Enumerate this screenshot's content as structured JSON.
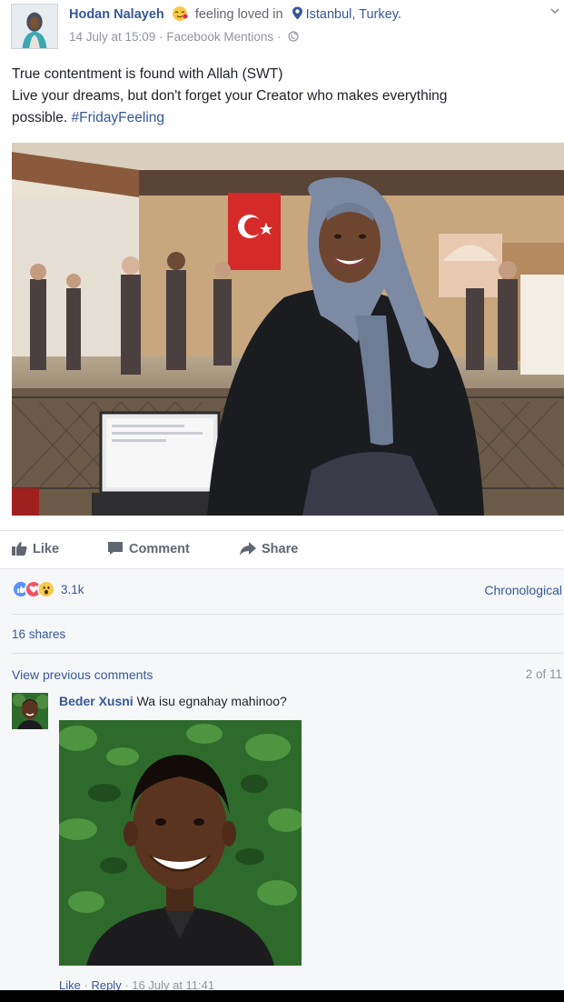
{
  "post": {
    "author": "Hodan Nalayeh",
    "feeling": "feeling loved in",
    "location": "Istanbul, Turkey.",
    "timestamp": "14 July at 15:09",
    "source": "Facebook Mentions",
    "separator": "·",
    "text_line1": "True contentment is found with Allah (SWT)",
    "text_line2": "Live your dreams, but don't forget your Creator who makes everything",
    "text_line3": "possible.",
    "hashtag": "#FridayFeeling",
    "icons": [
      "feeling-loved-emoji",
      "location-pin-icon",
      "globe-icon",
      "chevron-down-icon"
    ]
  },
  "actions": {
    "like": "Like",
    "comment": "Comment",
    "share": "Share"
  },
  "stats": {
    "reaction_count": "3.1k",
    "reaction_types": [
      "like-reaction-icon",
      "love-reaction-icon",
      "wow-reaction-icon"
    ],
    "sort": "Chronological",
    "shares": "16 shares",
    "view_previous": "View previous comments",
    "comment_count": "2 of 11"
  },
  "comment": {
    "author": "Beder Xusni",
    "text": "Wa isu egnahay mahinoo?",
    "like": "Like",
    "reply": "Reply",
    "separator": "·",
    "timestamp": "16 July at 11:41"
  },
  "colors": {
    "link_blue": "#365899",
    "text": "#1d2129",
    "muted": "#90949c",
    "background_gray": "#f6f7f9"
  }
}
